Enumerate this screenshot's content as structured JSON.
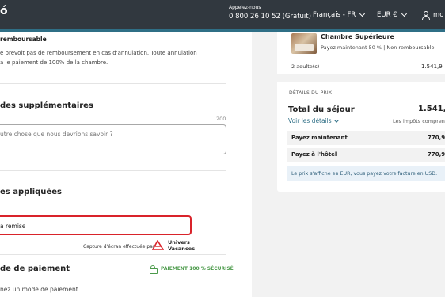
{
  "header": {
    "brand_fragment": "ó",
    "callus_label": "Appelez-nous",
    "callus_phone": "0 800 26 10 52 (Gratuit)",
    "language": "Français - FR",
    "currency": "EUR €",
    "user_fragment": "mo",
    "colors": {
      "bar": "#31383f",
      "accent": "#2f6f86"
    }
  },
  "summary": {
    "room_name": "Chambre Supérieure",
    "room_payment": "Payez maintenant 50 % | Non remboursable",
    "guests": "2 adulte(s)",
    "guests_price": "1.541,9",
    "details_label": "DÉTAILS DU PRIX",
    "total_label": "Total du séjour",
    "total_value": "1.541,9",
    "see_details": "Voir les détails",
    "taxes_note": "Les impôts compren",
    "pay_now_label": "Payez maintenant",
    "pay_now_value": "770,9",
    "pay_hotel_label": "Payez à l'hôtel",
    "pay_hotel_value": "770,9",
    "currency_note": "Le prix s'affiche en EUR, vous payez votre facture en USD."
  },
  "main": {
    "nonrefund_title": "remboursable",
    "nonrefund_line1": "e prévoit pas de remboursement en cas d'annulation. Toute annulation",
    "nonrefund_line2": "a le paiement de 100% de la chambre.",
    "requests_title": "des supplémentaires",
    "char_count": "200",
    "requests_placeholder": "utre chose que nous devrions savoir ?",
    "promo_title": "es appliquées",
    "promo_text": "a remise",
    "credit_text": "Capture d'écran effectuée par",
    "credit_logo_line1": "Univers",
    "credit_logo_line2": "Vacances",
    "payment_title": "de de paiement",
    "secure_label": "PAIEMENT 100 % SÉCURISÉ",
    "payment_sub": "nez un mode de paiement",
    "colors": {
      "promo_border": "#d9232a",
      "secure": "#4b9a4a",
      "link": "#2f6f86"
    }
  }
}
